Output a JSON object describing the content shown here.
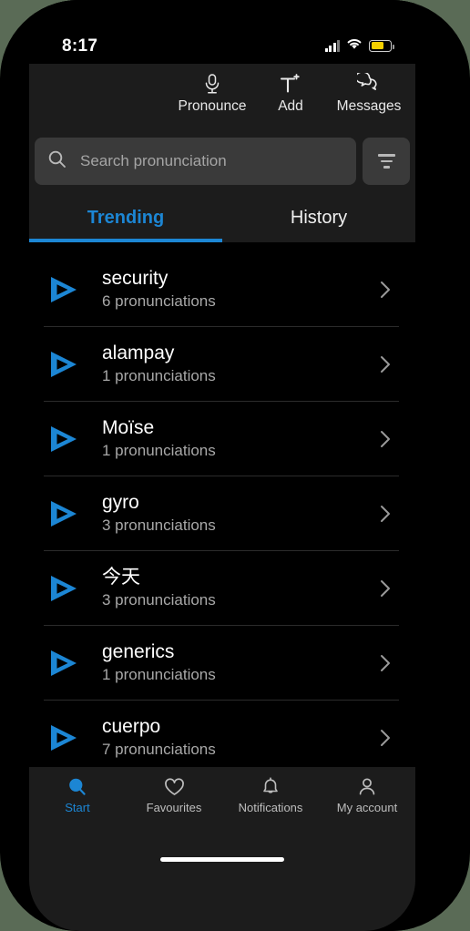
{
  "status_bar": {
    "time": "8:17",
    "signal_icon": "signal-bars-icon",
    "wifi_icon": "wifi-icon",
    "battery_icon": "battery-icon",
    "battery_color": "#f5d000"
  },
  "toolbar": {
    "items": [
      {
        "label": "Pronounce",
        "icon": "microphone-icon"
      },
      {
        "label": "Add",
        "icon": "add-text-icon"
      },
      {
        "label": "Messages",
        "icon": "messages-icon"
      }
    ]
  },
  "search": {
    "placeholder": "Search pronunciation",
    "value": "",
    "icon": "search-icon",
    "filter_icon": "filter-icon"
  },
  "tabs": {
    "items": [
      {
        "label": "Trending",
        "active": true
      },
      {
        "label": "History",
        "active": false
      }
    ],
    "active_color": "#1c86d4"
  },
  "list": {
    "items": [
      {
        "word": "security",
        "subtitle": "6 pronunciations",
        "play_icon": "play-icon",
        "chevron_icon": "chevron-right-icon"
      },
      {
        "word": "alampay",
        "subtitle": "1 pronunciations",
        "play_icon": "play-icon",
        "chevron_icon": "chevron-right-icon"
      },
      {
        "word": "Moïse",
        "subtitle": "1 pronunciations",
        "play_icon": "play-icon",
        "chevron_icon": "chevron-right-icon"
      },
      {
        "word": "gyro",
        "subtitle": "3 pronunciations",
        "play_icon": "play-icon",
        "chevron_icon": "chevron-right-icon"
      },
      {
        "word": "今天",
        "subtitle": "3 pronunciations",
        "play_icon": "play-icon",
        "chevron_icon": "chevron-right-icon"
      },
      {
        "word": "generics",
        "subtitle": "1 pronunciations",
        "play_icon": "play-icon",
        "chevron_icon": "chevron-right-icon"
      },
      {
        "word": "cuerpo",
        "subtitle": "7 pronunciations",
        "play_icon": "play-icon",
        "chevron_icon": "chevron-right-icon"
      }
    ],
    "play_color": "#1c86d4"
  },
  "bottom_nav": {
    "items": [
      {
        "label": "Start",
        "icon": "search-icon",
        "active": true
      },
      {
        "label": "Favourites",
        "icon": "heart-icon",
        "active": false
      },
      {
        "label": "Notifications",
        "icon": "bell-icon",
        "active": false
      },
      {
        "label": "My account",
        "icon": "person-icon",
        "active": false
      }
    ],
    "active_color": "#1c86d4"
  }
}
